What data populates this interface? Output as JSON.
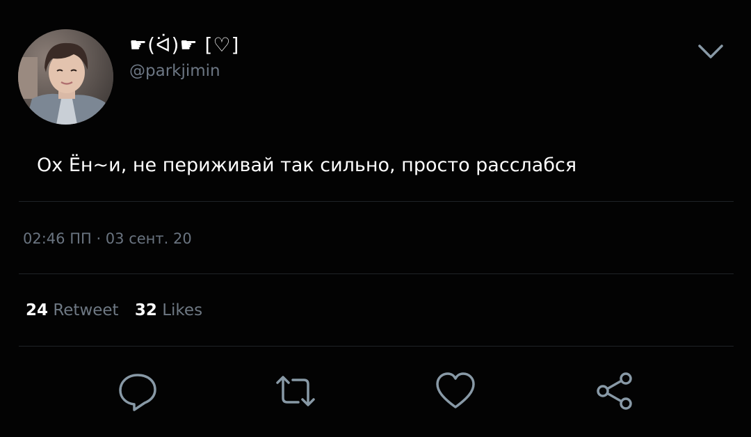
{
  "tweet": {
    "display_name": "☛(ᐛ)☛ [♡]",
    "handle": "@parkjimin",
    "text": "Ох Ён~и, не периживай так сильно, просто расслабся",
    "timestamp": "02:46 ПП · 03 сент. 20",
    "retweets": {
      "count": "24",
      "label": "Retweet"
    },
    "likes": {
      "count": "32",
      "label": "Likes"
    }
  },
  "icons": {
    "menu": "chevron-down-icon",
    "reply": "reply-icon",
    "retweet": "retweet-icon",
    "like": "heart-icon",
    "share": "share-icon"
  },
  "colors": {
    "background": "#030303",
    "text": "#ffffff",
    "muted": "#6d7784",
    "icon": "#8899a6",
    "divider": "#1f2327"
  }
}
